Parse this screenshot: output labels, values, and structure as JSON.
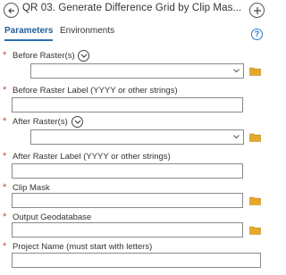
{
  "window": {
    "title": "QR 03. Generate Difference Grid by Clip Mas..."
  },
  "tabs": [
    {
      "label": "Parameters"
    },
    {
      "label": "Environments"
    }
  ],
  "params": [
    {
      "label": "Before Raster(s)",
      "required": "*",
      "value": ""
    },
    {
      "label": "Before Raster Label (YYYY or other strings)",
      "required": "*",
      "value": ""
    },
    {
      "label": "After Raster(s)",
      "required": "*",
      "value": ""
    },
    {
      "label": "After Raster Label (YYYY or other strings)",
      "required": "*",
      "value": ""
    },
    {
      "label": "Clip Mask",
      "required": "*",
      "value": ""
    },
    {
      "label": "Output Geodatabase",
      "required": "*",
      "value": ""
    },
    {
      "label": "Project Name (must start with letters)",
      "required": "*",
      "value": ""
    }
  ],
  "help": {
    "glyph": "?"
  },
  "colors": {
    "accent": "#2a6fb5",
    "required": "#c24a2d",
    "folder": "#e5a92b"
  }
}
